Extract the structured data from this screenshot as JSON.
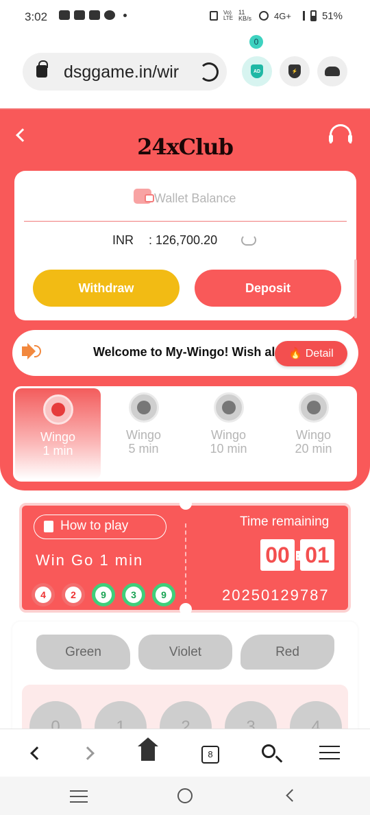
{
  "status_bar": {
    "time": "3:02",
    "network_speed": "11 KB/s",
    "network": "4G+",
    "battery": "51%"
  },
  "browser": {
    "url": "dsggame.in/wir",
    "ad_badge": "0",
    "ad_label": "AD",
    "tab_count": "8"
  },
  "header": {
    "brand": "24xClub"
  },
  "wallet": {
    "label": "Wallet Balance",
    "currency": "INR",
    "balance": ": 126,700.20",
    "withdraw_label": "Withdraw",
    "deposit_label": "Deposit"
  },
  "notice": {
    "text": "Welcome to My-Wingo! Wish al",
    "detail_label": "Detail"
  },
  "game_tabs": [
    {
      "line1": "Wingo",
      "line2": "1 min",
      "active": true
    },
    {
      "line1": "Wingo",
      "line2": "5 min",
      "active": false
    },
    {
      "line1": "Wingo",
      "line2": "10 min",
      "active": false
    },
    {
      "line1": "Wingo",
      "line2": "20 min",
      "active": false
    }
  ],
  "game": {
    "how_to_play": "How to play",
    "name": "Win Go 1 min",
    "recent_results": [
      {
        "value": "4",
        "color": "red"
      },
      {
        "value": "2",
        "color": "red"
      },
      {
        "value": "9",
        "color": "green"
      },
      {
        "value": "3",
        "color": "green"
      },
      {
        "value": "9",
        "color": "green"
      }
    ],
    "time_label": "Time remaining",
    "time_digits": [
      "00",
      "01"
    ],
    "colon": ":",
    "period": "20250129787"
  },
  "bet": {
    "green_label": "Green",
    "violet_label": "Violet",
    "red_label": "Red",
    "numbers": [
      "0",
      "1",
      "2",
      "3",
      "4"
    ]
  },
  "colors": {
    "primary_red": "#f95959",
    "withdraw_yellow": "#f2bb14",
    "result_green": "#3fcf7a"
  }
}
